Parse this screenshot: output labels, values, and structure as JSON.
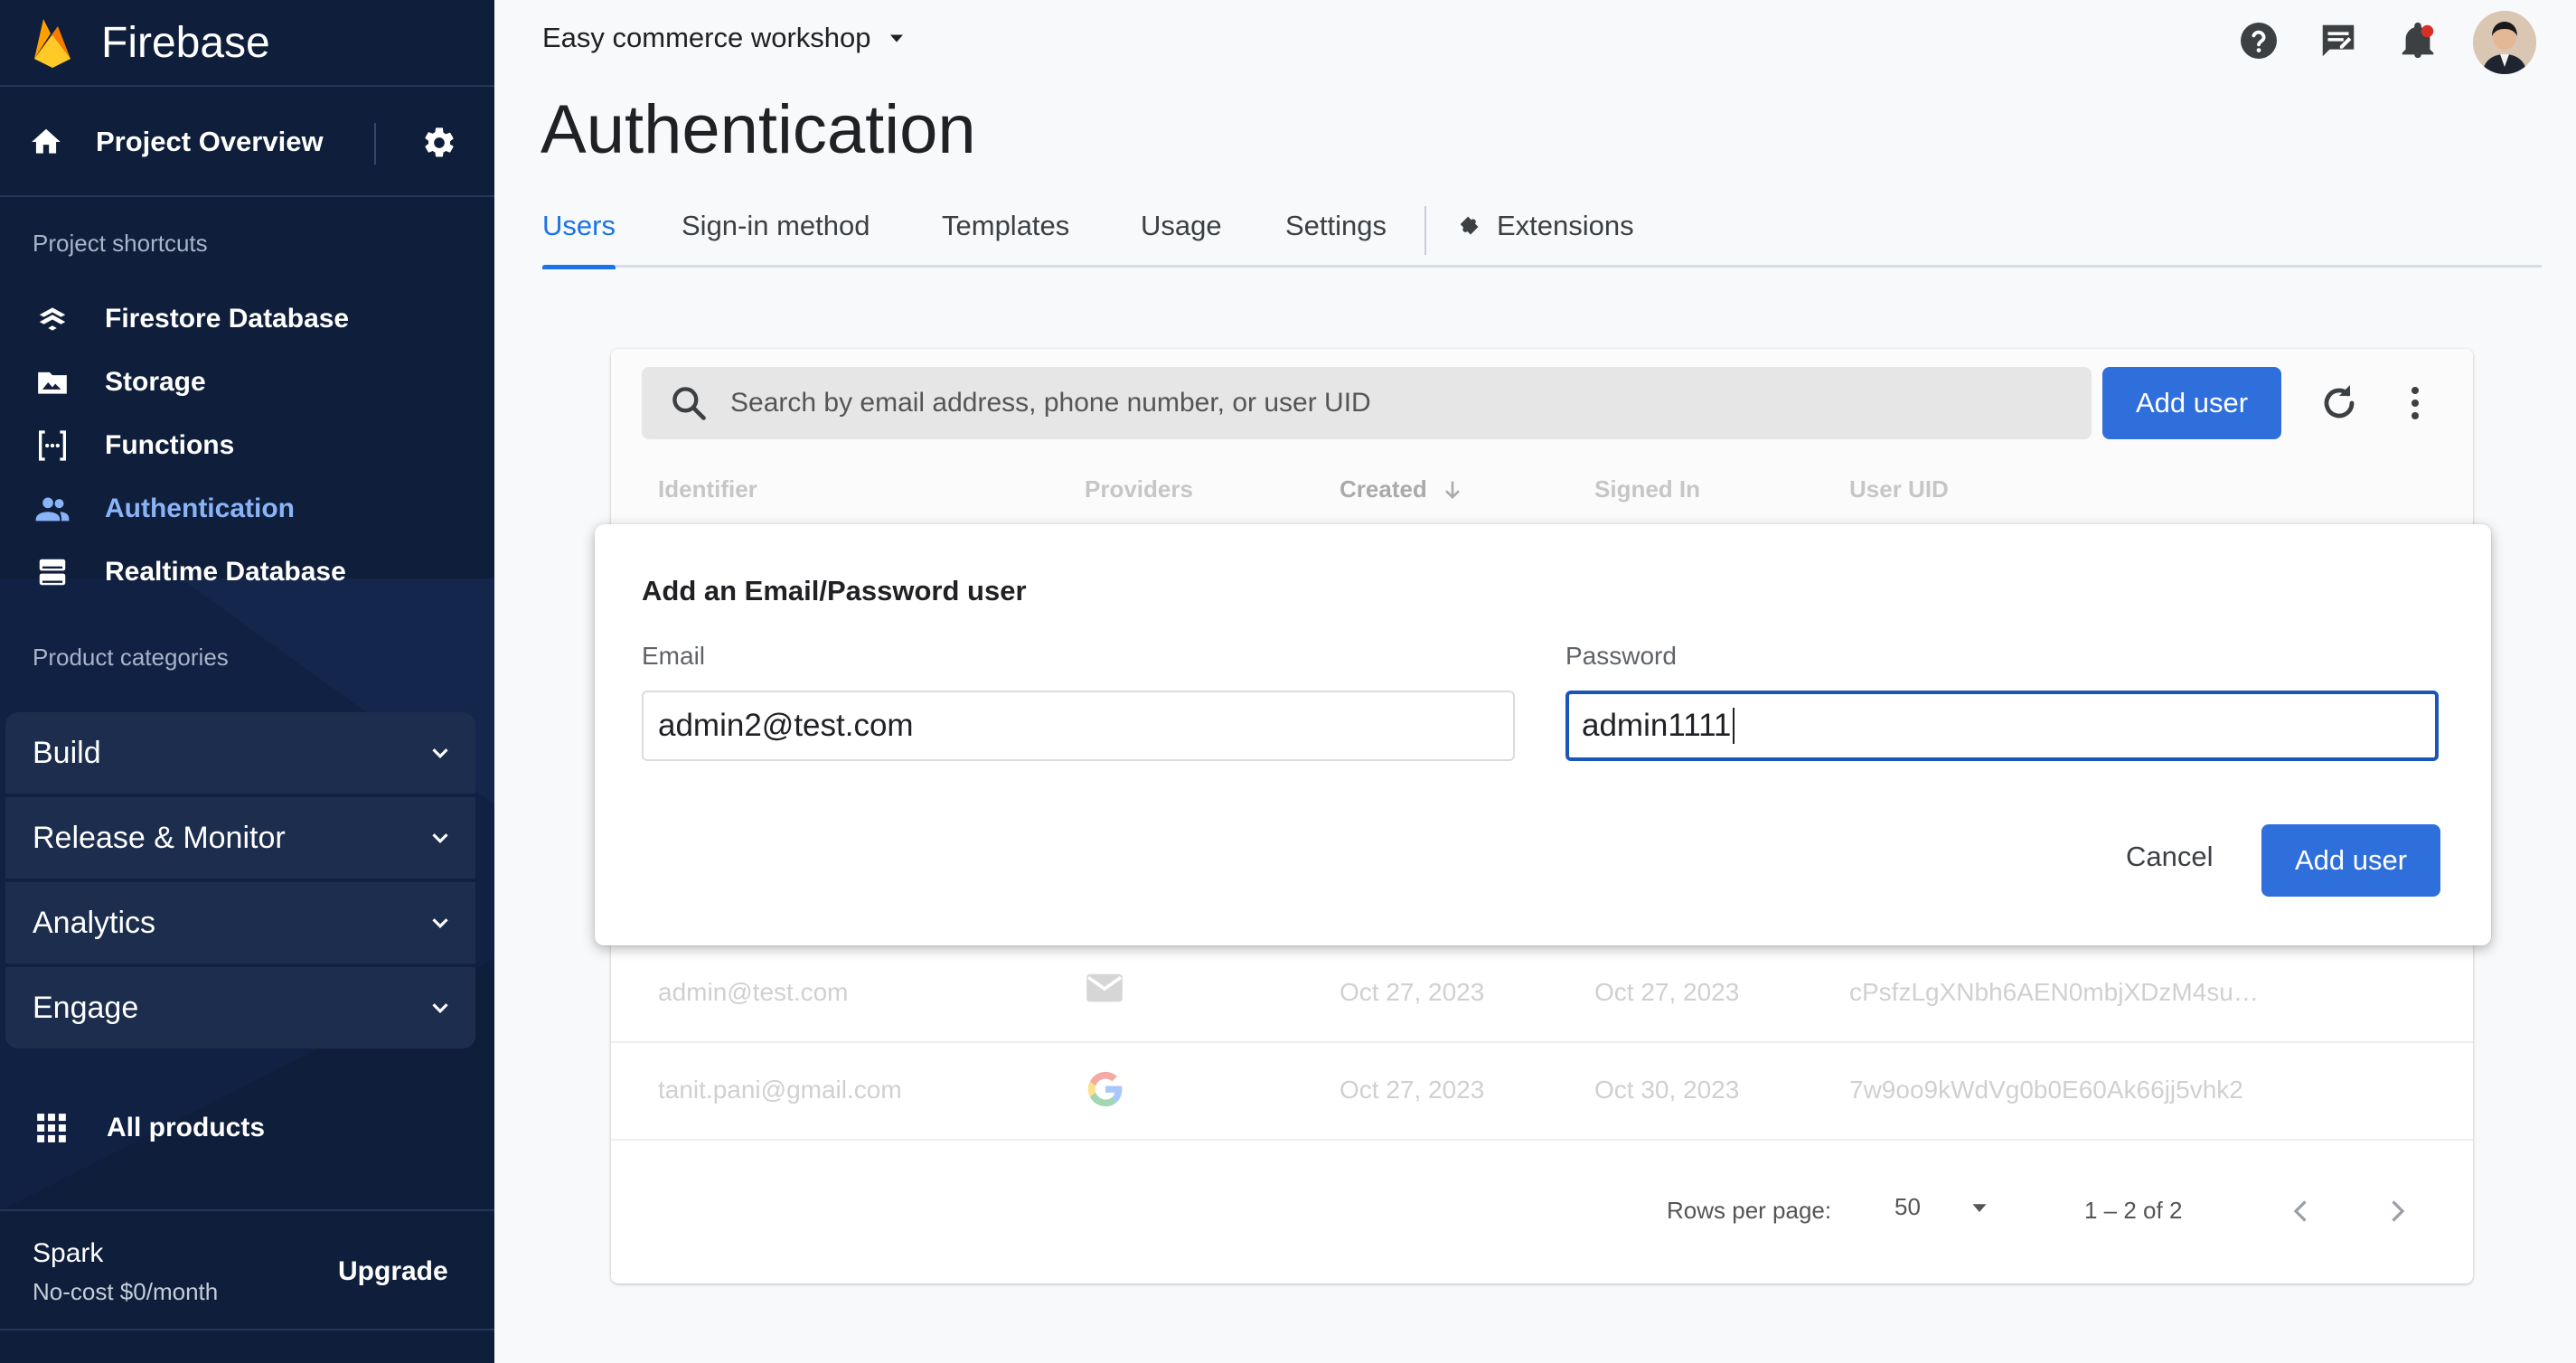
{
  "colors": {
    "sidebar_bg": "#0f1e3a",
    "accent": "#1a73e8",
    "primary_button": "#2f6fdc",
    "active_nav": "#8ab4f8"
  },
  "sidebar": {
    "brand": "Firebase",
    "project_overview": "Project Overview",
    "shortcuts_label": "Project shortcuts",
    "shortcuts": [
      {
        "label": "Firestore Database",
        "icon": "firestore-icon"
      },
      {
        "label": "Storage",
        "icon": "storage-icon"
      },
      {
        "label": "Functions",
        "icon": "functions-icon"
      },
      {
        "label": "Authentication",
        "icon": "authentication-icon",
        "active": true
      },
      {
        "label": "Realtime Database",
        "icon": "realtime-database-icon"
      }
    ],
    "categories_label": "Product categories",
    "categories": [
      "Build",
      "Release & Monitor",
      "Analytics",
      "Engage"
    ],
    "all_products": "All products",
    "plan": {
      "name": "Spark",
      "price": "No-cost $0/month",
      "upgrade": "Upgrade"
    }
  },
  "header": {
    "project_name": "Easy commerce workshop",
    "icons": [
      "help-icon",
      "release-notes-icon",
      "notifications-icon"
    ]
  },
  "page": {
    "title": "Authentication",
    "tabs": [
      "Users",
      "Sign-in method",
      "Templates",
      "Usage",
      "Settings",
      "Extensions"
    ],
    "active_tab": "Users"
  },
  "users": {
    "search_placeholder": "Search by email address, phone number, or user UID",
    "add_user_label": "Add user",
    "columns": [
      "Identifier",
      "Providers",
      "Created",
      "Signed In",
      "User UID"
    ],
    "rows": [
      {
        "identifier": "admin@test.com",
        "provider": "email-icon",
        "created": "Oct 27, 2023",
        "signed_in": "Oct 27, 2023",
        "uid": "cPsfzLgXNbh6AEN0mbjXDzM4su…"
      },
      {
        "identifier": "tanit.pani@gmail.com",
        "provider": "google-icon",
        "created": "Oct 27, 2023",
        "signed_in": "Oct 30, 2023",
        "uid": "7w9oo9kWdVg0b0E60Ak66jj5vhk2"
      }
    ],
    "footer": {
      "rows_per_page_label": "Rows per page:",
      "rows_per_page": "50",
      "range": "1 – 2 of 2"
    }
  },
  "dialog": {
    "title": "Add an Email/Password user",
    "email_label": "Email",
    "email_value": "admin2@test.com",
    "password_label": "Password",
    "password_value": "admin1111",
    "cancel": "Cancel",
    "submit": "Add user"
  }
}
